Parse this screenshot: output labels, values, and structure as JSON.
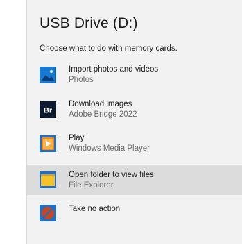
{
  "dialog": {
    "title": "USB Drive (D:)",
    "subtitle": "Choose what to do with memory cards."
  },
  "options": [
    {
      "label": "Import photos and videos",
      "app": "Photos",
      "icon": "photos-icon"
    },
    {
      "label": "Download images",
      "app": "Adobe Bridge 2022",
      "icon": "adobe-bridge-icon",
      "icon_text": "Br"
    },
    {
      "label": "Play",
      "app": "Windows Media Player",
      "icon": "media-player-icon"
    },
    {
      "label": "Open folder to view files",
      "app": "File Explorer",
      "icon": "folder-icon",
      "selected": true
    },
    {
      "label": "Take no action",
      "app": "",
      "icon": "no-action-icon"
    }
  ],
  "colors": {
    "panel_bg": "#f2f2f2",
    "selected_bg": "#dcdcdc",
    "photos_blue": "#0a5fb4",
    "bridge_dark": "#0b1a2f",
    "media_orange": "#f08a1c",
    "folder_yellow": "#f5c32c",
    "no_action_red": "#c8471e"
  }
}
